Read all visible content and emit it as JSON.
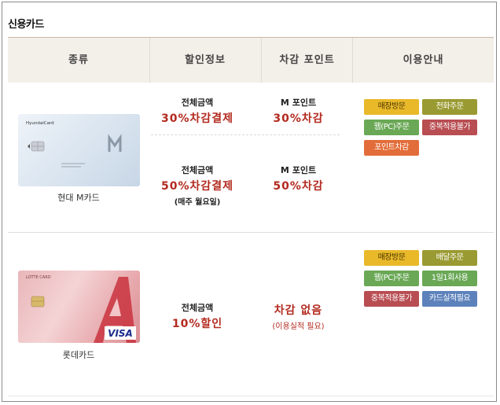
{
  "section_title": "신용카드",
  "header": {
    "col_type": "종류",
    "col_discount": "할인정보",
    "col_points": "차감 포인트",
    "col_usage": "이용안내"
  },
  "cards": [
    {
      "name": "현대 M카드",
      "card_brand_text": "HyundaiCard",
      "offers": [
        {
          "label": "전체금액",
          "value": "30%차감결제",
          "note": "",
          "points_label": "M 포인트",
          "points_value": "30%차감"
        },
        {
          "label": "전체금액",
          "value": "50%차감결제",
          "note": "(매주 월요일)",
          "points_label": "M 포인트",
          "points_value": "50%차감"
        }
      ],
      "badges": [
        "매장방문",
        "전화주문",
        "웹(PC)주문",
        "중복적용불가",
        "포인트차감"
      ]
    },
    {
      "name": "롯데카드",
      "card_brand_text": "LOTTE CARD",
      "network": "VISA",
      "offers": [
        {
          "label": "전체금액",
          "value": "10%할인",
          "note": "",
          "points_label": "",
          "points_value": "차감 없음",
          "points_note": "(이용실적 필요)"
        }
      ],
      "badges": [
        "매장방문",
        "배달주문",
        "웹(PC)주문",
        "1일1회사용",
        "중복적용불가",
        "카드실적필요"
      ]
    }
  ],
  "colors": {
    "header_bg": "#f3efe9",
    "accent_red": "#b32a1f",
    "badge_yellow": "#e9b92a",
    "badge_olive": "#9a9a32",
    "badge_green": "#6aa856",
    "badge_red": "#b84d52",
    "badge_orange": "#e36d3a",
    "badge_blue": "#5d82bb"
  }
}
